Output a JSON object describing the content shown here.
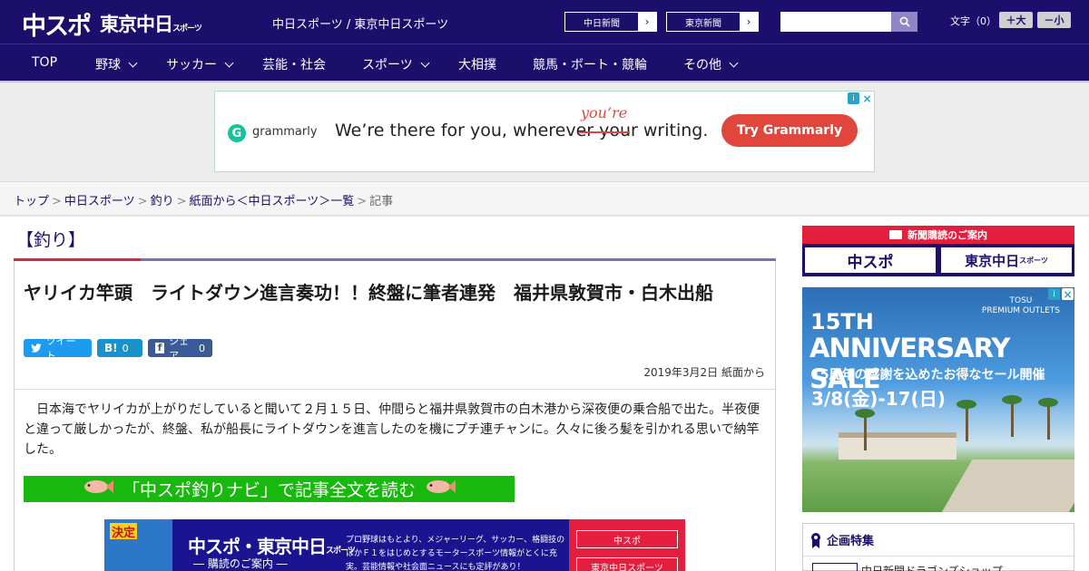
{
  "header": {
    "logo_main": "中スポ",
    "logo_sub": "東京中日",
    "logo_sub_small": "スポーツ",
    "site_name": "中日スポーツ / 東京中日スポーツ",
    "links": [
      {
        "label": "中日新聞"
      },
      {
        "label": "東京新聞"
      }
    ],
    "search_placeholder": "",
    "font_label": "文字（0）",
    "font_larger": "＋大",
    "font_smaller": "－小"
  },
  "nav": {
    "items": [
      {
        "label": "TOP",
        "dropdown": false
      },
      {
        "label": "野球",
        "dropdown": true
      },
      {
        "label": "サッカー",
        "dropdown": true
      },
      {
        "label": "芸能・社会",
        "dropdown": false
      },
      {
        "label": "スポーツ",
        "dropdown": true
      },
      {
        "label": "大相撲",
        "dropdown": false
      },
      {
        "label": "競馬・ボート・競輪",
        "dropdown": false
      },
      {
        "label": "その他",
        "dropdown": true
      }
    ]
  },
  "ad_top": {
    "brand": "grammarly",
    "text": "We’re there for you, wherever your writing.",
    "correction": "you’re",
    "button": "Try Grammarly"
  },
  "breadcrumb": {
    "items": [
      "トップ",
      "中日スポーツ",
      "釣り",
      "紙面から＜中日スポーツ＞一覧"
    ],
    "current": "記事",
    "separator": ">"
  },
  "article": {
    "category": "【釣り】",
    "headline": "ヤリイカ竿頭　ライトダウン進言奏功！！終盤に筆者連発　福井県敦賀市・白木出船",
    "share": {
      "tweet": "ツイート",
      "hatena_icon": "B!",
      "hatena_count": "0",
      "facebook": "シェア",
      "facebook_count": "0"
    },
    "date": "2019年3月2日 紙面から",
    "lead": "日本海でヤリイカが上がりだしていると聞いて２月１５日、仲間らと福井県敦賀市の白木港から深夜便の乗合船で出た。半夜便と違って厳しかったが、終盤、私が船長にライトダウンを進言したのを機にプチ連チャンに。久々に後ろ髪を引かれる思いで納竿した。",
    "navi_link": "「中スポ釣りナビ」で記事全文を読む"
  },
  "subscribe_banner": {
    "tag": "決定",
    "title": "中スポ・東京中日",
    "title_small": "スポーツ",
    "subtitle": "― 購読のご案内 ―",
    "description": "プロ野球はもとより、メジャーリーグ、サッカー、格闘技のほかＦ１をはじめとするモータースポーツ情報がとくに充実。芸能情報や社会面ニュースにも定評があり！",
    "buttons": [
      "中スポ",
      "東京中日スポーツ"
    ]
  },
  "sidebar": {
    "subscribe_head": "新聞購読のご案内",
    "subscribe_a": "中スポ",
    "subscribe_b": "東京中日",
    "subscribe_b_small": "スポーツ",
    "ad": {
      "brand_line1": "TOSU",
      "brand_line2": "PREMIUM OUTLETS",
      "line1": "15TH",
      "line2": "ANNIVERSARY SALE",
      "line3": "15周年の感謝を込めたお得なセール開催",
      "line4": "3/8(金)-17(日)"
    },
    "feature_head": "企画特集",
    "feature_item": "中日新聞ドラゴンズショップ"
  }
}
